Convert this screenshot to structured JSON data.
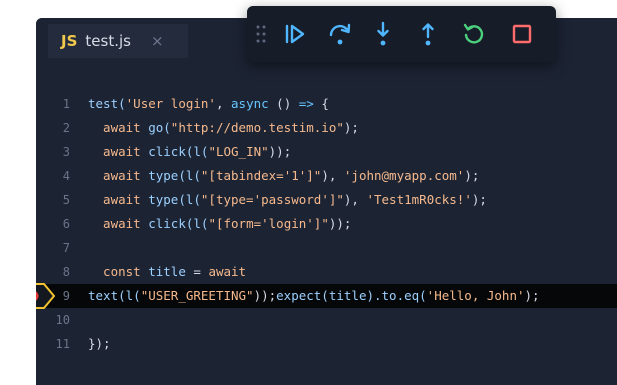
{
  "tab": {
    "lang_badge": "JS",
    "filename": "test.js",
    "close_glyph": "×"
  },
  "debug_toolbar": {
    "buttons": [
      {
        "name": "continue-icon"
      },
      {
        "name": "step-over-icon"
      },
      {
        "name": "step-into-icon"
      },
      {
        "name": "step-out-icon"
      },
      {
        "name": "restart-icon"
      },
      {
        "name": "stop-icon"
      }
    ]
  },
  "colors": {
    "editor_bg": "#1c2333",
    "accent_blue": "#4fb6ff",
    "restart_green": "#4cd07d",
    "stop_red": "#ff6b6b",
    "breakpoint_yellow": "#f4c430",
    "breakpoint_red": "#e53935"
  },
  "code": {
    "highlighted_line": "9",
    "lines": [
      {
        "num": "1",
        "tokens": [
          {
            "t": "test(",
            "c": "fn"
          },
          {
            "t": "'User login'",
            "c": "str"
          },
          {
            "t": ", ",
            "c": "plain"
          },
          {
            "t": "async",
            "c": "acc"
          },
          {
            "t": " () ",
            "c": "plain"
          },
          {
            "t": "=>",
            "c": "acc"
          },
          {
            "t": " {",
            "c": "plain"
          }
        ]
      },
      {
        "num": "2",
        "tokens": [
          {
            "t": "  await ",
            "c": "kw"
          },
          {
            "t": "go(",
            "c": "fn"
          },
          {
            "t": "\"http://demo.testim.io\"",
            "c": "str"
          },
          {
            "t": ");",
            "c": "plain"
          }
        ]
      },
      {
        "num": "3",
        "tokens": [
          {
            "t": "  await ",
            "c": "kw"
          },
          {
            "t": "click(l(",
            "c": "fn"
          },
          {
            "t": "\"LOG_IN\"",
            "c": "str"
          },
          {
            "t": "));",
            "c": "plain"
          }
        ]
      },
      {
        "num": "4",
        "tokens": [
          {
            "t": "  await ",
            "c": "kw"
          },
          {
            "t": "type(l(",
            "c": "fn"
          },
          {
            "t": "\"[tabindex='1']\"",
            "c": "str"
          },
          {
            "t": "), ",
            "c": "plain"
          },
          {
            "t": "'john@myapp.com'",
            "c": "str"
          },
          {
            "t": ");",
            "c": "plain"
          }
        ]
      },
      {
        "num": "5",
        "tokens": [
          {
            "t": "  await ",
            "c": "kw"
          },
          {
            "t": "type(l(",
            "c": "fn"
          },
          {
            "t": "\"[type='password']\"",
            "c": "str"
          },
          {
            "t": "), ",
            "c": "plain"
          },
          {
            "t": "'Test1mR0cks!'",
            "c": "str"
          },
          {
            "t": ");",
            "c": "plain"
          }
        ]
      },
      {
        "num": "6",
        "tokens": [
          {
            "t": "  await ",
            "c": "kw"
          },
          {
            "t": "click(l(",
            "c": "fn"
          },
          {
            "t": "\"[form='login']\"",
            "c": "str"
          },
          {
            "t": "));",
            "c": "plain"
          }
        ]
      },
      {
        "num": "7",
        "tokens": []
      },
      {
        "num": "8",
        "tokens": [
          {
            "t": "  const ",
            "c": "kw"
          },
          {
            "t": "title",
            "c": "fn"
          },
          {
            "t": " = ",
            "c": "plain"
          },
          {
            "t": "await",
            "c": "kw"
          }
        ]
      },
      {
        "num": "9",
        "tokens": [
          {
            "t": "text(l(",
            "c": "fn"
          },
          {
            "t": "\"USER_GREETING\"",
            "c": "str"
          },
          {
            "t": "));",
            "c": "plain"
          },
          {
            "t": "expect(title).to.eq(",
            "c": "fn"
          },
          {
            "t": "'Hello, John'",
            "c": "str"
          },
          {
            "t": ");",
            "c": "plain"
          }
        ]
      },
      {
        "num": "10",
        "tokens": []
      },
      {
        "num": "11",
        "tokens": [
          {
            "t": "});",
            "c": "plain"
          }
        ]
      }
    ]
  }
}
